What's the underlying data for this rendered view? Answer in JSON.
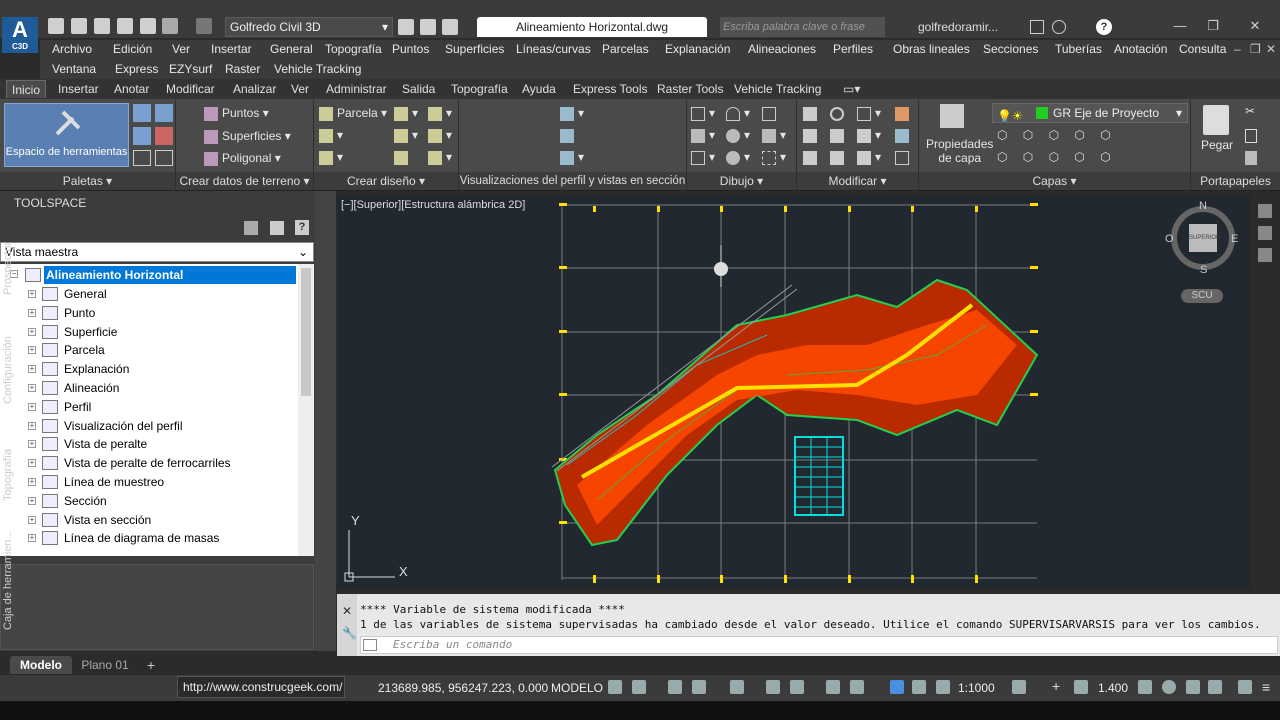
{
  "app": {
    "logo": "A",
    "logo_sub": "C3D",
    "workspace": "Golfredo Civil 3D",
    "document_title": "Alineamiento Horizontal.dwg",
    "search_placeholder": "Escriba palabra clave o frase",
    "user": "golfredoramir..."
  },
  "menu": {
    "row1": [
      "Archivo",
      "Edición",
      "Ver",
      "Insertar",
      "General",
      "Topografía",
      "Puntos",
      "Superficies",
      "Líneas/curvas",
      "Parcelas",
      "Explanación",
      "Alineaciones",
      "Perfiles",
      "Obras lineales",
      "Secciones",
      "Tuberías",
      "Anotación",
      "Consulta"
    ],
    "row2": [
      "Ventana",
      "Express",
      "EZYsurf",
      "Raster",
      "Vehicle Tracking"
    ]
  },
  "ribbon_tabs": [
    "Inicio",
    "Insertar",
    "Anotar",
    "Modificar",
    "Analizar",
    "Ver",
    "Administrar",
    "Salida",
    "Topografía",
    "Ayuda",
    "Express Tools",
    "Raster Tools",
    "Vehicle Tracking"
  ],
  "ribbon": {
    "big_tool": "Espacio de herramientas",
    "terrain": [
      "Puntos",
      "Superficies",
      "Poligonal"
    ],
    "design": [
      "Parcela"
    ],
    "layer_props": [
      "Propiedades",
      "de capa"
    ],
    "layer_current": "GR Eje de Proyecto",
    "paste": "Pegar",
    "panels": [
      "Paletas",
      "Crear datos de terreno",
      "Crear diseño",
      "Visualizaciones del perfil y vistas en sección",
      "Dibujo",
      "Modificar",
      "Capas",
      "Portapapeles"
    ]
  },
  "toolspace": {
    "title": "TOOLSPACE",
    "view_select": "Vista maestra",
    "root": "Alineamiento Horizontal",
    "items": [
      "General",
      "Punto",
      "Superficie",
      "Parcela",
      "Explanación",
      "Alineación",
      "Perfil",
      "Visualización del perfil",
      "Vista de peralte",
      "Vista de peralte de ferrocarriles",
      "Línea de muestreo",
      "Sección",
      "Vista en sección",
      "Línea de diagrama de masas"
    ],
    "side_tabs": [
      "Prospector",
      "Configuración",
      "Topografía",
      "Caja de herramien..."
    ]
  },
  "viewport": {
    "label": "[−][Superior][Estructura alámbrica 2D]",
    "compass": {
      "n": "N",
      "s": "S",
      "e": "E",
      "o": "O",
      "cube": "SUPERIOR"
    },
    "ucs": "SCU",
    "axis_y": "Y",
    "axis_x": "X"
  },
  "command": {
    "history": [
      "**** Variable de sistema modificada ****",
      "1 de las variables de sistema supervisadas ha cambiado desde el valor deseado. Utilice el comando SUPERVISARVARSIS para ver los cambios."
    ],
    "placeholder": "Escriba un comando"
  },
  "layout_tabs": [
    "Modelo",
    "Plano 01"
  ],
  "status": {
    "url": "http://www.construcgeek.com/",
    "coordinates": "213689.985, 956247.223, 0.000",
    "mode": "MODELO",
    "scale": "1:1000",
    "lineweight": "1.400"
  },
  "colors": {
    "accent": "#0078d7",
    "terrain": "#ff4a00",
    "contours": "#20d050",
    "alignment": "#ffe000",
    "cyan": "#00e0e0"
  }
}
